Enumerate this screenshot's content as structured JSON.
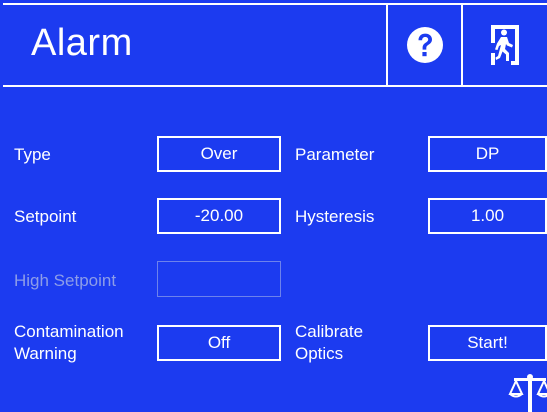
{
  "header": {
    "title": "Alarm",
    "help_icon": "question-circle-icon",
    "exit_icon": "emergency-exit-icon"
  },
  "rows": {
    "type": {
      "label": "Type",
      "value": "Over"
    },
    "parameter": {
      "label": "Parameter",
      "value": "DP"
    },
    "setpoint": {
      "label": "Setpoint",
      "value": "-20.00"
    },
    "hysteresis": {
      "label": "Hysteresis",
      "value": "1.00"
    },
    "high_setpoint": {
      "label": "High Setpoint",
      "value": ""
    },
    "contamination": {
      "label": "Contamination\nWarning",
      "value": "Off"
    },
    "calibrate": {
      "label": "Calibrate\nOptics",
      "value": "Start!"
    }
  },
  "footer": {
    "icon": "balance-scale-icon"
  },
  "colors": {
    "background": "#1c3bf0",
    "foreground": "#ffffff",
    "disabled_text": "#8d9de8"
  }
}
